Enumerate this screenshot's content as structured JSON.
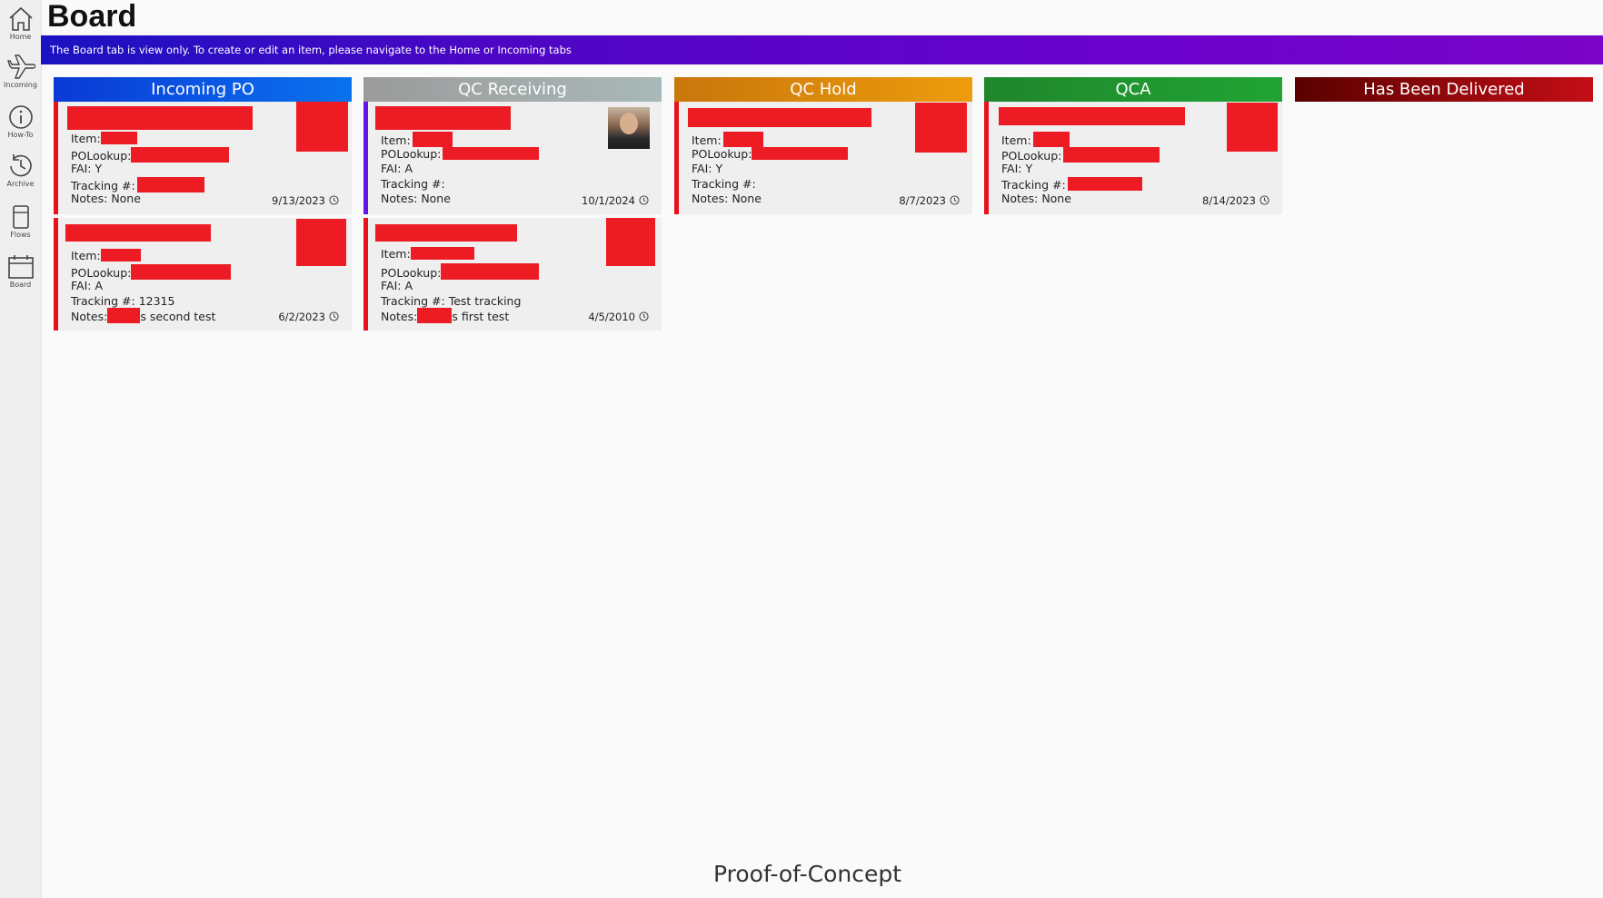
{
  "nav": [
    {
      "label": "Home",
      "icon": "home-icon"
    },
    {
      "label": "Incoming",
      "icon": "airplane-icon"
    },
    {
      "label": "How-To",
      "icon": "info-icon"
    },
    {
      "label": "Archive",
      "icon": "history-icon"
    },
    {
      "label": "Flows",
      "icon": "notebook-icon"
    },
    {
      "label": "Board",
      "icon": "calendar-icon"
    }
  ],
  "page": {
    "title": "Board",
    "banner": "The Board tab is view only. To create or edit an item, please navigate to the Home or Incoming tabs",
    "footer": "Proof-of-Concept"
  },
  "columns": [
    {
      "title": "Incoming PO",
      "color": "#0a5ae0"
    },
    {
      "title": "QC Receiving",
      "color": "#a3a8a8"
    },
    {
      "title": "QC Hold",
      "color": "#e08a0c"
    },
    {
      "title": "QCA",
      "color": "#219a31"
    },
    {
      "title": "Has Been Delivered",
      "color": "#9a080e"
    }
  ],
  "labels": {
    "item": "Item:",
    "po_lookup": "POLookup:",
    "fai": "FAI:",
    "tracking": "Tracking #:",
    "notes": "Notes:"
  },
  "cards": {
    "incoming_1": {
      "fai": "Y",
      "tracking": "",
      "notes": "None",
      "date": "9/13/2023"
    },
    "incoming_2": {
      "fai": "A",
      "tracking": "12315",
      "notes_suffix": "s second test",
      "date": "6/2/2023"
    },
    "qcr_1": {
      "fai": "A",
      "tracking": "",
      "notes": "None",
      "date": "10/1/2024"
    },
    "qcr_2": {
      "fai": "A",
      "tracking": "Test tracking",
      "notes_suffix": "s first test",
      "date": "4/5/2010"
    },
    "hold_1": {
      "fai": "Y",
      "tracking": "",
      "notes": "None",
      "date": "8/7/2023"
    },
    "qca_1": {
      "fai": "Y",
      "tracking": "",
      "notes": "None",
      "date": "8/14/2023"
    }
  },
  "colors": {
    "accent_red": "#e8121c",
    "accent_purple": "#6414e8",
    "redaction": "#ed1c24"
  }
}
